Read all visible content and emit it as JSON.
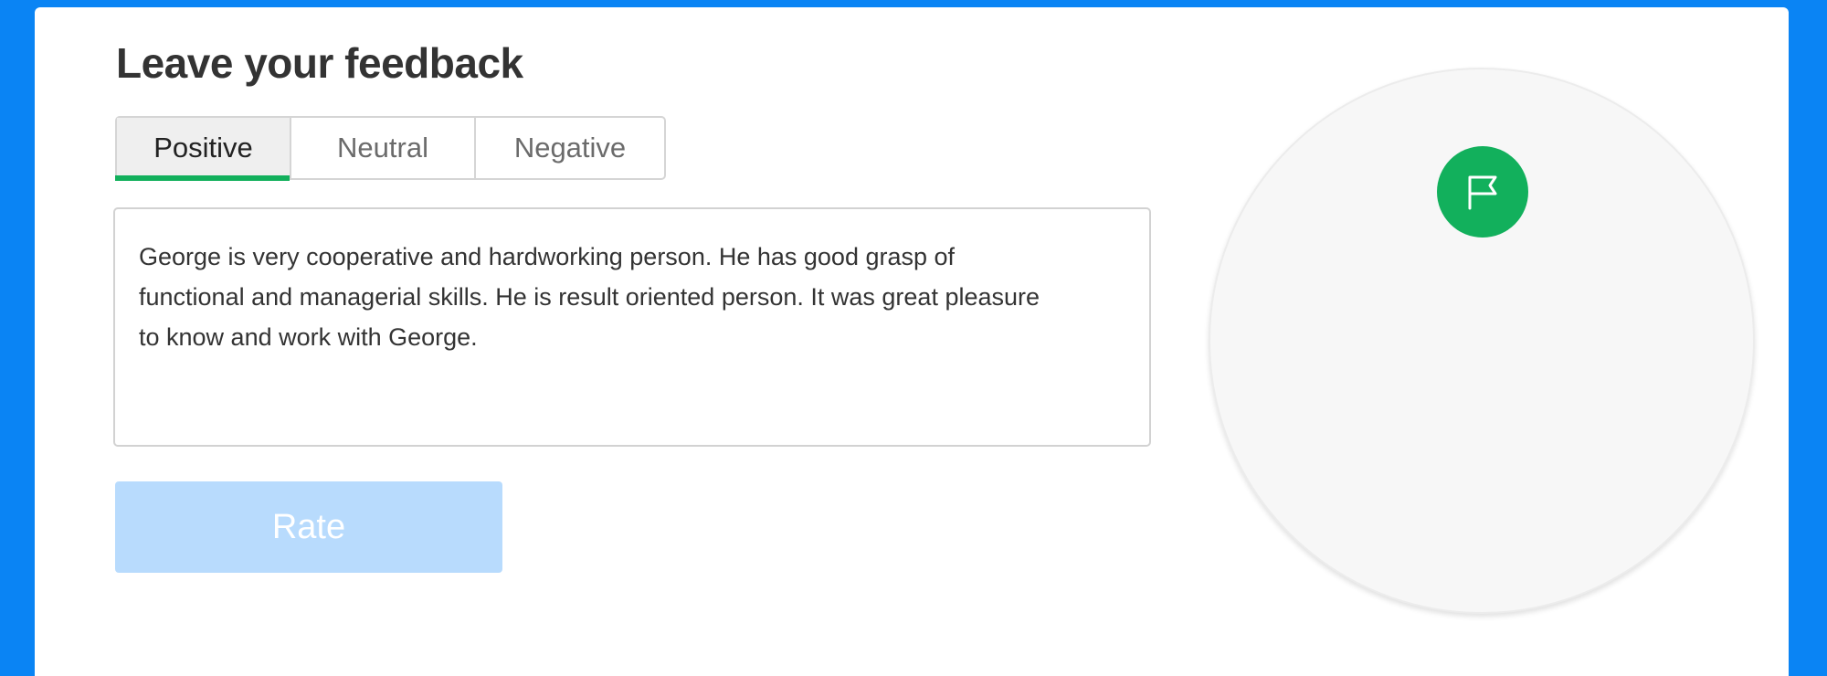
{
  "heading": "Leave your feedback",
  "tabs": [
    {
      "label": "Positive",
      "active": true
    },
    {
      "label": "Neutral",
      "active": false
    },
    {
      "label": "Negative",
      "active": false
    }
  ],
  "feedback": {
    "text": "George is very cooperative and hardworking person. He has good grasp of functional and managerial skills. He is result oriented person. It was great pleasure to know and work with George."
  },
  "rate_button": {
    "label": "Rate",
    "disabled": true
  },
  "badge": {
    "icon": "flag-icon",
    "color": "#12b05c"
  },
  "colors": {
    "background": "#0a84f4",
    "accent": "#12b05c",
    "button_disabled": "#b8dbfd"
  }
}
